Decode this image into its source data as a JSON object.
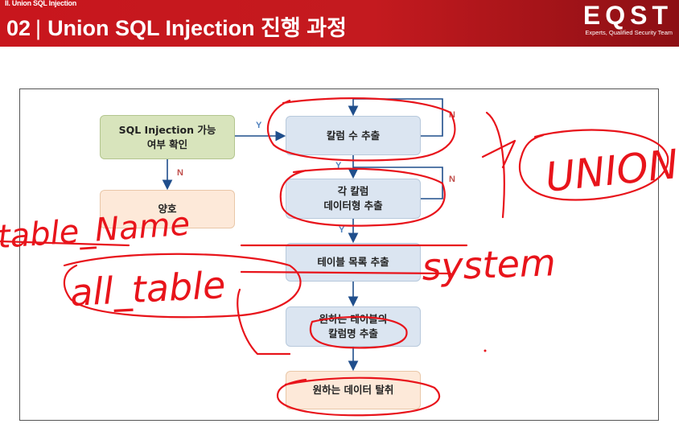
{
  "header": {
    "breadcrumb": "II. Union SQL Injection",
    "number": "02",
    "divider": "|",
    "title": "Union SQL Injection 진행 과정"
  },
  "logo": {
    "brand": "EQST",
    "tagline": "Experts, Qualified Security Team"
  },
  "flowchart": {
    "start": "SQL Injection 가능\n여부 확인",
    "safe": "양호",
    "step1": "칼럼 수 추출",
    "step2": "각 칼럼\n데이터형 추출",
    "step3": "테이블 목록 추출",
    "step4": "원하는 테이블의\n칼럼명 추출",
    "step5": "원하는 데이터 탈취",
    "yes_label": "Y",
    "no_label": "N"
  },
  "annotations": {
    "union": "UNION",
    "table_name": "table_Name",
    "all_table": "all_table",
    "system": "system"
  },
  "colors": {
    "header_red": "#c8161d",
    "ink_red": "#e8141b",
    "arrow_blue": "#1f4e8c"
  }
}
